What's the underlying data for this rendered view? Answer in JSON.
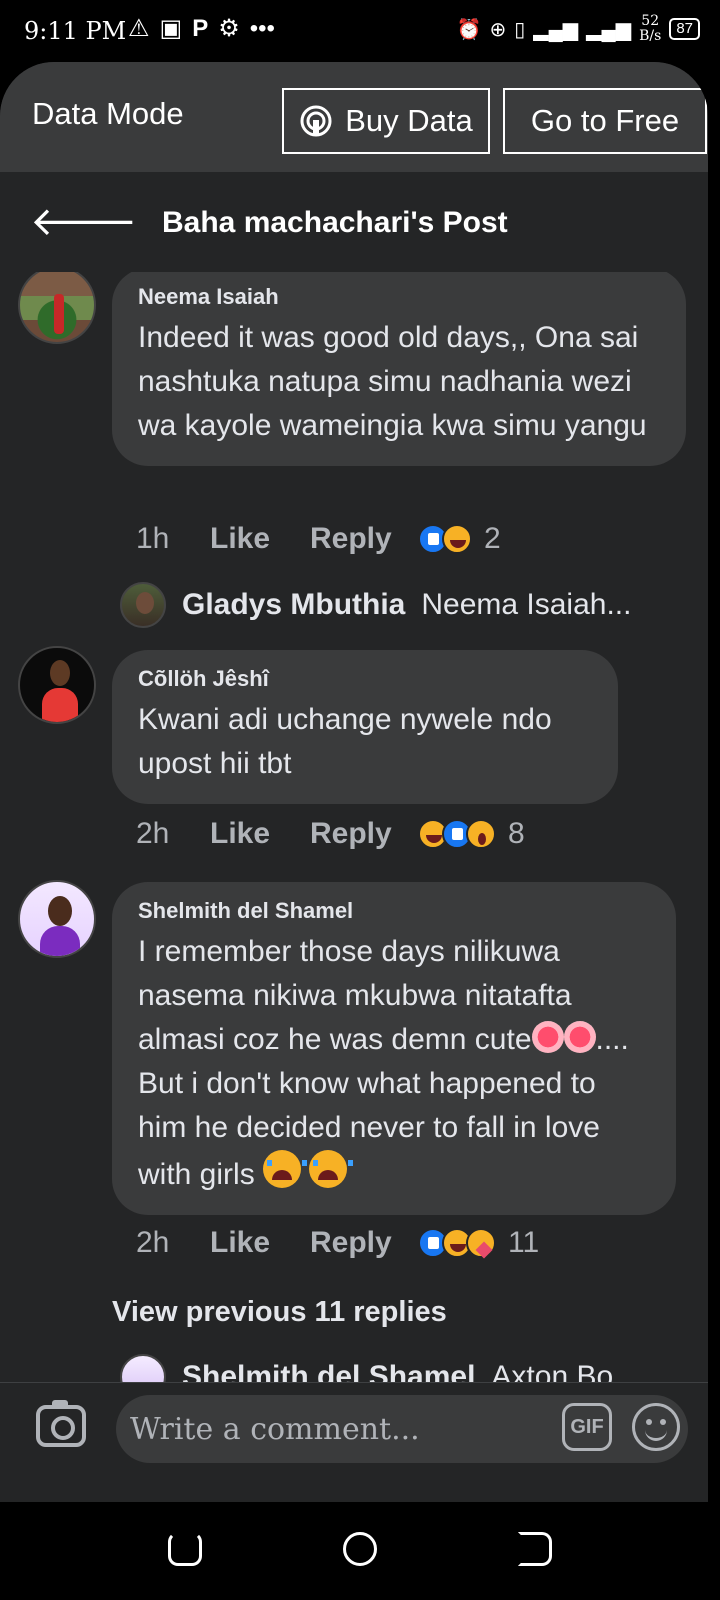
{
  "status_bar": {
    "time": "9:11 PM",
    "net_speed_value": "52",
    "net_speed_unit": "B/s",
    "battery": "87"
  },
  "data_mode": {
    "label": "Data Mode",
    "buy_data": "Buy Data",
    "go_to_free": "Go to Free"
  },
  "header": {
    "title": "Baha machachari's Post"
  },
  "comments": [
    {
      "author": "Neema Isaiah",
      "text": "Indeed it was good old days,, Ona sai nashtuka natupa simu nadhania wezi wa kayole wameingia kwa simu yangu",
      "time": "1h",
      "like": "Like",
      "reply": "Reply",
      "reactions": [
        "like",
        "haha"
      ],
      "count": "2",
      "reply_preview": {
        "author": "Gladys Mbuthia",
        "snippet": "Neema Isaiah..."
      }
    },
    {
      "author": "Cõllöh Jêshî",
      "text": "Kwani adi uchange nywele ndo upost hii tbt",
      "time": "2h",
      "like": "Like",
      "reply": "Reply",
      "reactions": [
        "haha",
        "like",
        "wow"
      ],
      "count": "8"
    },
    {
      "author": "Shelmith del Shamel",
      "text_part1": "I remember those days nilikuwa nasema nikiwa mkubwa nitatafta almasi coz he was demn cute",
      "text_part2": ".... But i don't know what happened to him he decided never to fall in love with girls",
      "time": "2h",
      "like": "Like",
      "reply": "Reply",
      "reactions": [
        "like",
        "haha",
        "care"
      ],
      "count": "11"
    }
  ],
  "view_previous": "View previous 11 replies",
  "last_reply_preview": {
    "author": "Shelmith del Shamel",
    "snippet": "Axton Bo..."
  },
  "composer": {
    "placeholder": "Write a comment...",
    "gif_label": "GIF"
  }
}
